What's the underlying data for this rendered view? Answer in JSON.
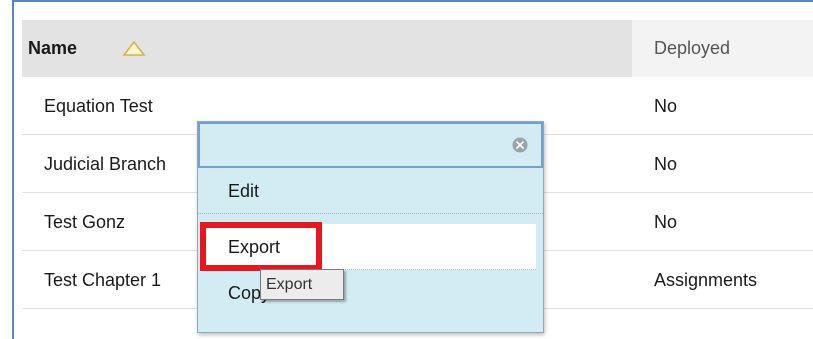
{
  "table": {
    "columns": {
      "name": "Name",
      "deployed": "Deployed"
    },
    "rows": [
      {
        "name": "Equation Test",
        "deployed": "No"
      },
      {
        "name": "Judicial Branch",
        "deployed": "No"
      },
      {
        "name": "Test Gonz",
        "deployed": "No"
      },
      {
        "name": "Test Chapter 1",
        "deployed": "Assignments"
      }
    ]
  },
  "menu": {
    "items": [
      {
        "label": "Edit"
      },
      {
        "label": "Export"
      },
      {
        "label": "Copy"
      }
    ],
    "selected": "Export"
  },
  "tooltip": {
    "text": "Export"
  },
  "icons": {
    "sort": "sort-ascending-icon",
    "close": "close-icon"
  },
  "colors": {
    "highlight": "#e3191f",
    "menu_bg": "#d3ebf2",
    "header_bg": "#e3e3e3"
  }
}
